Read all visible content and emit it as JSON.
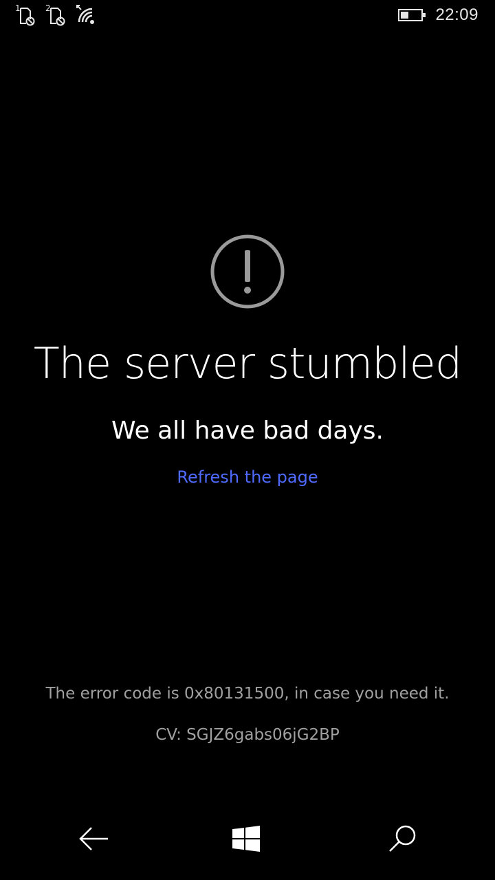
{
  "status_bar": {
    "sim1_label": "1",
    "sim2_label": "2",
    "sim1_icon": "sim-no-service-icon",
    "sim2_icon": "sim-no-service-icon",
    "wifi_icon": "wifi-icon",
    "battery_icon": "battery-icon",
    "battery_level": 0.4,
    "time": "22:09"
  },
  "error": {
    "icon": "alert-circle-icon",
    "title": "The server stumbled",
    "subtitle": "We all have bad days.",
    "refresh_label": "Refresh the page",
    "error_code_text": "The error code is 0x80131500, in case you need it.",
    "cv_text": "CV: SGJZ6gabs06jG2BP"
  },
  "nav_bar": {
    "back_icon": "back-arrow-icon",
    "home_icon": "windows-logo-icon",
    "search_icon": "search-icon"
  },
  "colors": {
    "background": "#000000",
    "text": "#ffffff",
    "link": "#4f6bff",
    "muted": "#a0a0a0",
    "icon_gray": "#9a9a9a"
  }
}
